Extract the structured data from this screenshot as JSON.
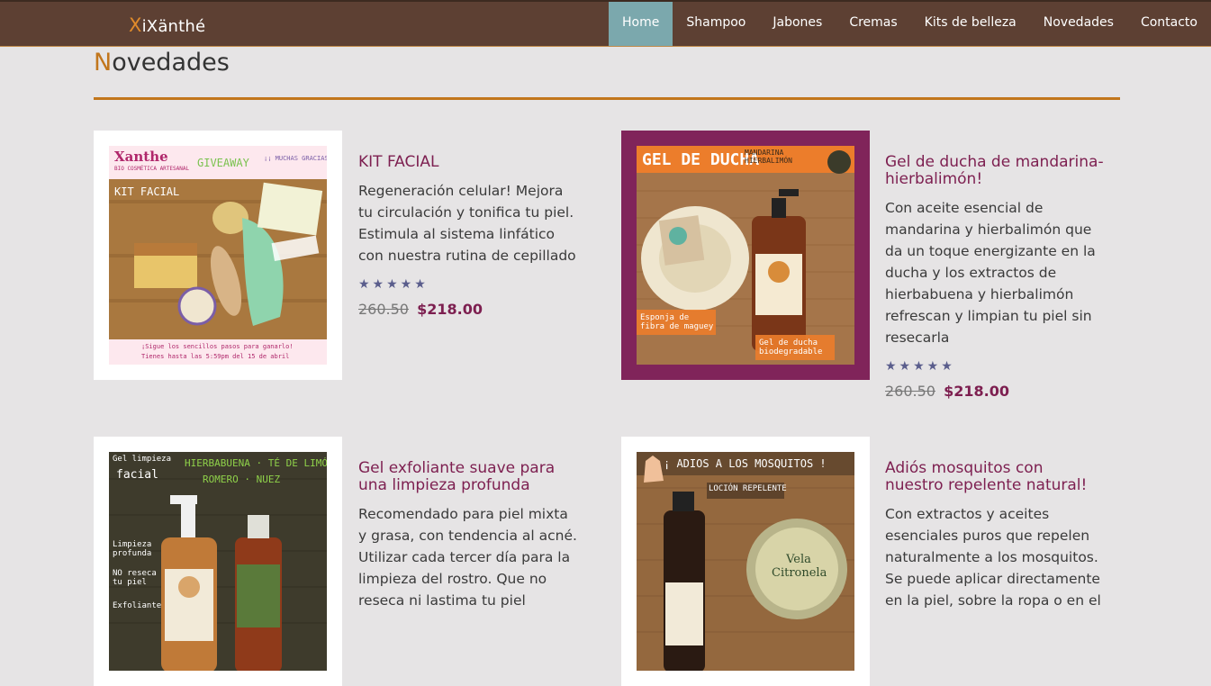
{
  "brand": {
    "initial": "X",
    "name": "iXänthé"
  },
  "nav": [
    {
      "label": "Home",
      "active": true
    },
    {
      "label": "Shampoo"
    },
    {
      "label": "Jabones"
    },
    {
      "label": "Cremas"
    },
    {
      "label": "Kits de belleza"
    },
    {
      "label": "Novedades"
    },
    {
      "label": "Contacto"
    }
  ],
  "page": {
    "title_initial": "N",
    "title_rest": "ovedades"
  },
  "colors": {
    "nav_bg": "#5d4033",
    "active": "#7ba8ad",
    "accent": "#c2761c",
    "product_title": "#7d1f50",
    "stars": "#5a5d8c"
  },
  "products": [
    {
      "title": "KIT FACIAL",
      "description": "Regeneración celular! Mejora tu circulación y tonifica tu piel. Estimula al sistema linfático con nuestra rutina de cepillado",
      "stars": "★★★★★",
      "old_price": "260.50",
      "price": "$218.00",
      "photo": {
        "brand": "Xanthe",
        "tag": "BIO COSMÉTICA ARTESANAL",
        "giveaway": "GIVEAWAY",
        "thanks": "¡¡ MUCHAS GRACIAS !!",
        "kit": "KIT FACIAL",
        "caption1": "¡Sigue los sencillos pasos para ganarlo!",
        "caption2": "Tienes hasta las 5:59pm del 15 de abril"
      }
    },
    {
      "title": "Gel de ducha de mandarina-hierbalimón!",
      "description": "Con aceite esencial de mandarina y hierbalimón que da un toque energizante en la ducha y los extractos de hierbabuena y hierbalimón refrescan y limpian tu piel sin resecarla",
      "stars": "★★★★★",
      "old_price": "260.50",
      "price": "$218.00",
      "photo": {
        "heading": "GEL DE DUCHA",
        "sub": "MANDARINA HIERBALIMÓN",
        "sponge": "Esponja de fibra de maguey",
        "gel": "Gel de ducha biodegradable"
      }
    },
    {
      "title": "Gel exfoliante suave para una limpieza profunda",
      "description": "Recomendado para piel mixta y grasa, con tendencia al acné. Utilizar cada tercer día para la limpieza del rostro. Que no reseca ni lastima tu piel",
      "photo": {
        "l1": "Gel limpieza",
        "l2": "facial",
        "l3": "HIERBABUENA · TÉ DE LIMÓN",
        "l4": "ROMERO · NUEZ",
        "l5": "Limpieza profunda",
        "l6": "NO reseca tu piel",
        "l7": "Exfoliante"
      }
    },
    {
      "title": "Adiós mosquitos con nuestro repelente natural!",
      "description": "Con extractos y aceites esenciales puros que repelen naturalmente a los mosquitos. Se puede aplicar directamente en la piel, sobre la ropa o en el",
      "photo": {
        "heading": "¡ ADIOS A LOS MOSQUITOS !",
        "lotion": "LOCIÓN REPELENTE",
        "candle": "Vela Citronela"
      }
    }
  ]
}
